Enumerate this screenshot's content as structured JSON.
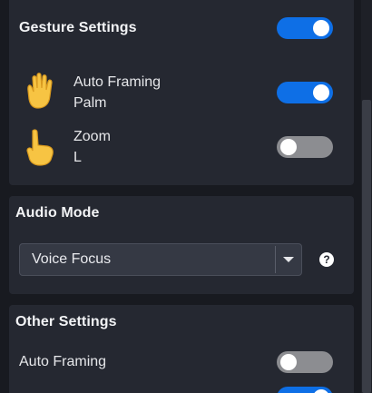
{
  "gesture_settings": {
    "title": "Gesture Settings",
    "toggle_on": true,
    "items": [
      {
        "line1": "Auto Framing",
        "line2": "Palm",
        "icon": "raised-hand-emoji-icon",
        "on": true
      },
      {
        "line1": "Zoom",
        "line2": "L",
        "icon": "pointing-finger-emoji-icon",
        "on": false
      }
    ]
  },
  "audio_mode": {
    "title": "Audio Mode",
    "selected": "Voice Focus",
    "help_glyph": "?"
  },
  "other_settings": {
    "title": "Other Settings",
    "items": [
      {
        "label": "Auto Framing",
        "on": false
      },
      {
        "label": "",
        "on": true
      }
    ]
  },
  "colors": {
    "accent": "#0e6fe6",
    "toggle_off": "#8c8d91",
    "card": "#252831",
    "background": "#181a20"
  }
}
